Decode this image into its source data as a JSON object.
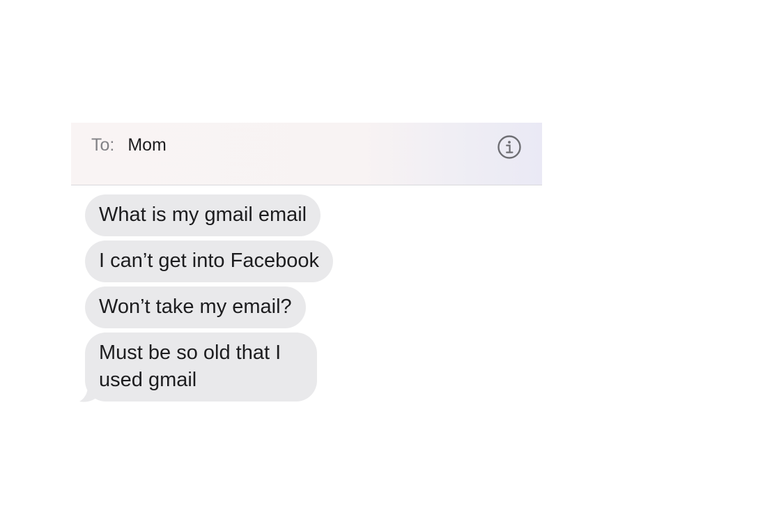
{
  "header": {
    "to_label": "To:",
    "recipient": "Mom",
    "info_icon": "info-circle-icon"
  },
  "messages": [
    {
      "text": "What is my gmail email"
    },
    {
      "text": "I can’t get into Facebook"
    },
    {
      "text": "Won’t take my email?"
    },
    {
      "text": "Must be so old that I used gmail"
    }
  ],
  "colors": {
    "incoming_bubble": "#e9e9eb",
    "text": "#1d1d1f",
    "label": "#828286"
  }
}
